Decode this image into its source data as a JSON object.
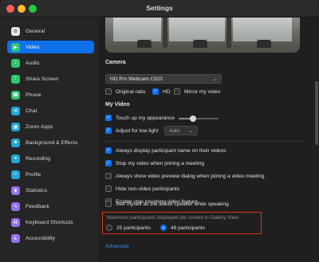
{
  "window": {
    "title": "Settings"
  },
  "sidebar": {
    "items": [
      {
        "label": "General",
        "icon": "gear-icon",
        "color": "#e6e6e6",
        "active": false
      },
      {
        "label": "Video",
        "icon": "video-camera-icon",
        "color": "#2dc86e",
        "active": true
      },
      {
        "label": "Audio",
        "icon": "headphones-icon",
        "color": "#2dc86e",
        "active": false
      },
      {
        "label": "Share Screen",
        "icon": "share-screen-icon",
        "color": "#2dc86e",
        "active": false
      },
      {
        "label": "Phone",
        "icon": "phone-icon",
        "color": "#2dc86e",
        "active": false
      },
      {
        "label": "Chat",
        "icon": "chat-bubble-icon",
        "color": "#1fa7d8",
        "active": false
      },
      {
        "label": "Zoom Apps",
        "icon": "apps-icon",
        "color": "#1fa7d8",
        "active": false
      },
      {
        "label": "Background & Effects",
        "icon": "person-background-icon",
        "color": "#1fa7d8",
        "active": false
      },
      {
        "label": "Recording",
        "icon": "record-icon",
        "color": "#1fa7d8",
        "active": false
      },
      {
        "label": "Profile",
        "icon": "profile-icon",
        "color": "#1fa7d8",
        "active": false
      },
      {
        "label": "Statistics",
        "icon": "statistics-icon",
        "color": "#9b6cf0",
        "active": false
      },
      {
        "label": "Feedback",
        "icon": "feedback-icon",
        "color": "#9b6cf0",
        "active": false
      },
      {
        "label": "Keyboard Shortcuts",
        "icon": "keyboard-icon",
        "color": "#9b6cf0",
        "active": false
      },
      {
        "label": "Accessibility",
        "icon": "accessibility-icon",
        "color": "#9b6cf0",
        "active": false
      }
    ]
  },
  "camera": {
    "section_title": "Camera",
    "selected": "HD Pro Webcam C920",
    "options": [
      {
        "label": "Original ratio",
        "checked": false
      },
      {
        "label": "HD",
        "checked": true
      },
      {
        "label": "Mirror my video",
        "checked": false
      }
    ]
  },
  "my_video": {
    "section_title": "My Video",
    "touch_up": {
      "label": "Touch up my appearance",
      "checked": true,
      "level": 0.35
    },
    "low_light": {
      "label": "Adjust for low light",
      "checked": true,
      "mode": "Auto"
    }
  },
  "general_options": [
    {
      "label": "Always display participant name on their videos",
      "checked": true
    },
    {
      "label": "Stop my video when joining a meeting",
      "checked": true
    },
    {
      "label": "Always show video preview dialog when joining a video meeting",
      "checked": false
    },
    {
      "label": "Hide non-video participants",
      "checked": false
    },
    {
      "label": "Enable stop incoming video feature",
      "checked": false
    },
    {
      "label": "See myself as the active speaker while speaking",
      "checked": false
    }
  ],
  "gallery": {
    "title": "Maximum participants displayed per screen in Gallery View:",
    "options": [
      {
        "label": "25 participants",
        "selected": false
      },
      {
        "label": "49 participants",
        "selected": true
      }
    ]
  },
  "advanced_link": "Advanced",
  "colors": {
    "accent": "#0e71eb",
    "highlight_border": "#d8321e",
    "link": "#3d8ef3"
  }
}
